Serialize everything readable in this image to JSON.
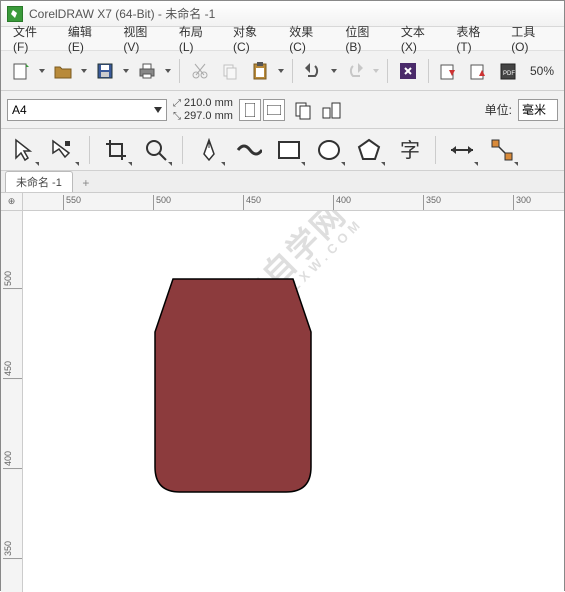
{
  "title": "CorelDRAW X7 (64-Bit) - 未命名 -1",
  "menu": {
    "file": "文件(F)",
    "edit": "编辑(E)",
    "view": "视图(V)",
    "layout": "布局(L)",
    "object": "对象(C)",
    "effects": "效果(C)",
    "bitmap": "位图(B)",
    "text": "文本(X)",
    "table": "表格(T)",
    "tools": "工具(O)"
  },
  "toolbar": {
    "zoom": "50%"
  },
  "props": {
    "page_size": "A4",
    "width": "210.0 mm",
    "height": "297.0 mm",
    "unit_label": "单位:",
    "unit_value": "毫米"
  },
  "doc_tab": "未命名 -1",
  "ruler_h": [
    "550",
    "500",
    "450",
    "400",
    "350",
    "300"
  ],
  "ruler_v": [
    "500",
    "450",
    "400",
    "350"
  ],
  "watermark": {
    "main": "软件自学网",
    "sub": "WWW.RJZXW.COM"
  },
  "ruler_corner": "⊕",
  "colors": {
    "shape_fill": "#8c3b3d",
    "shape_stroke": "#000000"
  }
}
